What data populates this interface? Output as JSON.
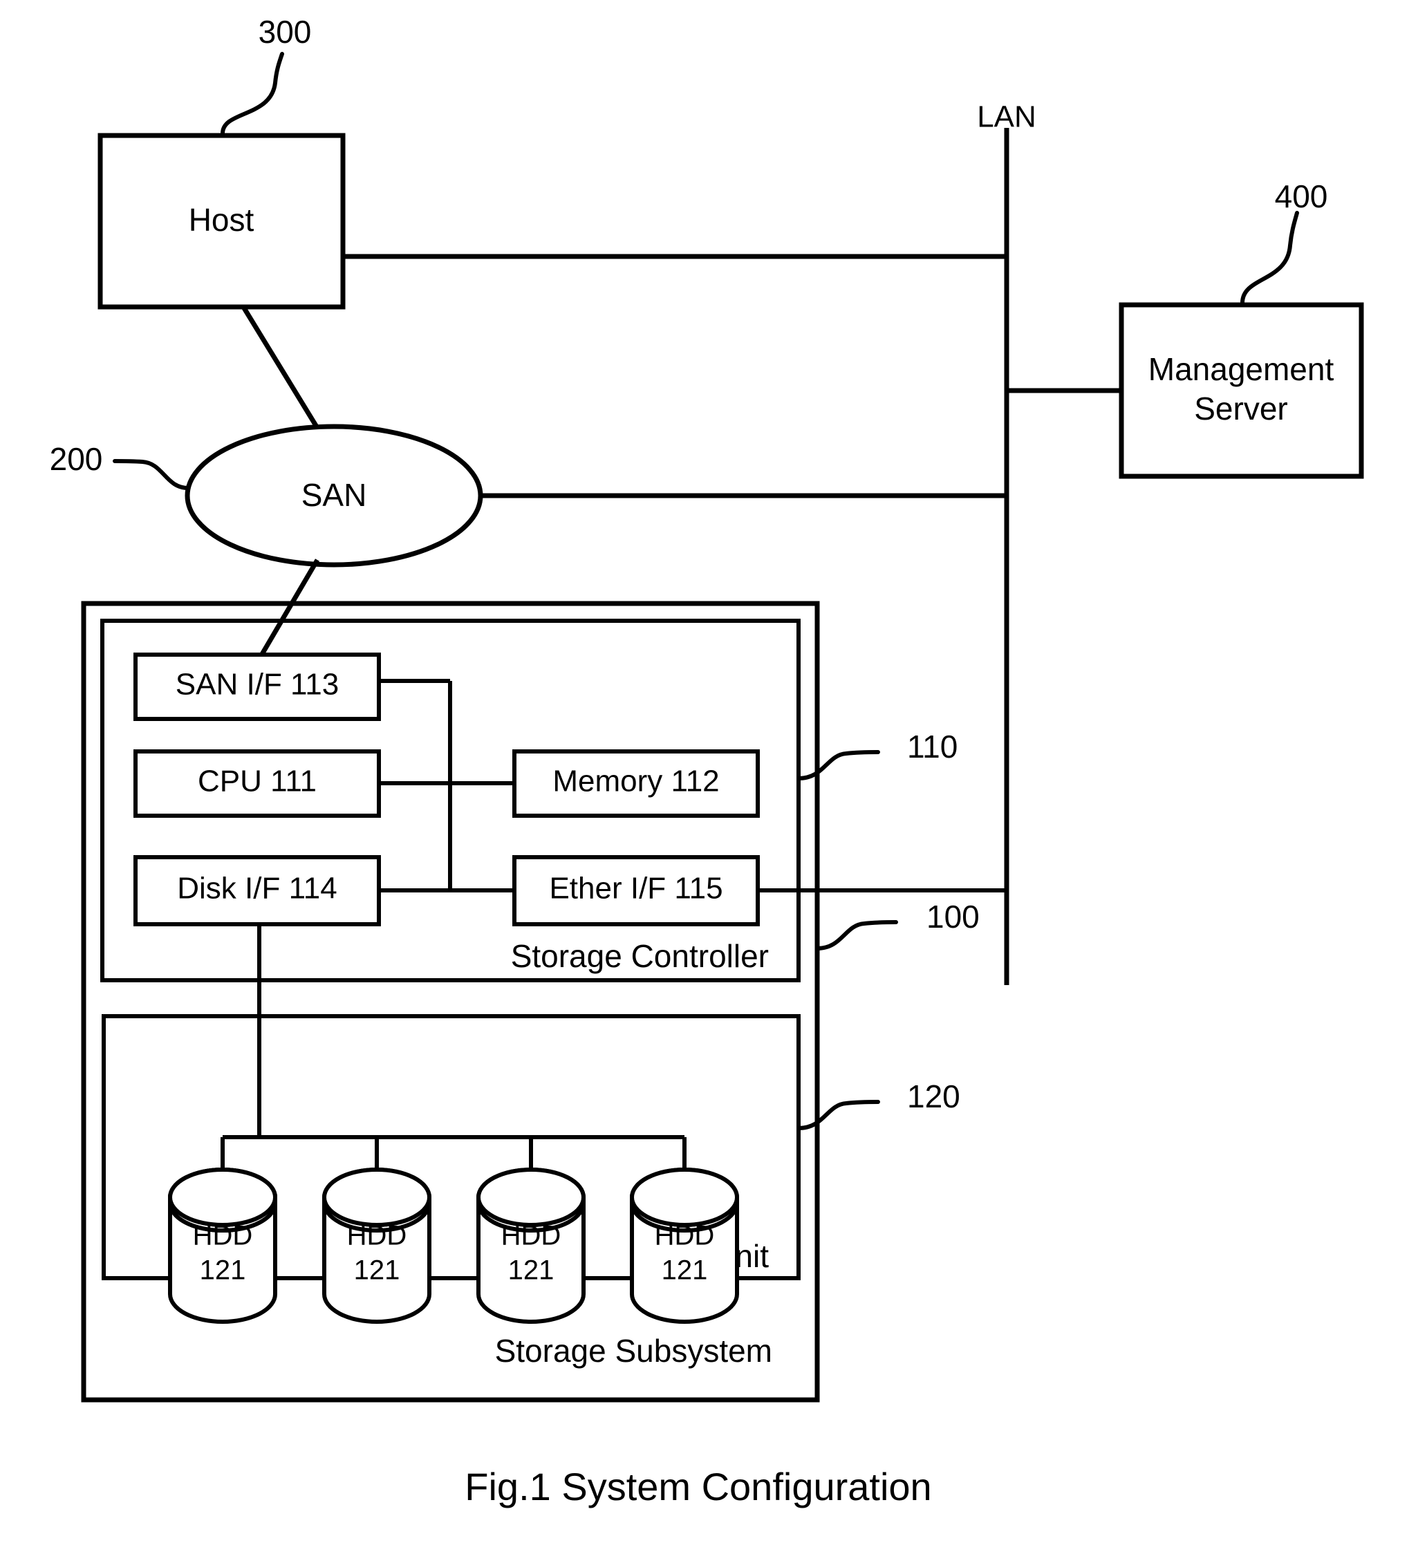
{
  "figure": {
    "caption": "Fig.1 System Configuration"
  },
  "nodes": {
    "host": {
      "label": "Host",
      "ref": "300"
    },
    "san": {
      "label": "SAN",
      "ref": "200"
    },
    "lan": {
      "label": "LAN"
    },
    "management_server": {
      "label_line1": "Management",
      "label_line2": "Server",
      "ref": "400"
    },
    "storage_subsystem": {
      "label": "Storage Subsystem",
      "ref": "100"
    },
    "storage_controller": {
      "label": "Storage Controller",
      "ref": "110"
    },
    "disk_unit": {
      "label": "Disk Unit",
      "ref": "120"
    }
  },
  "controller_components": [
    {
      "id": "san-if",
      "label": "SAN I/F 113"
    },
    {
      "id": "cpu",
      "label": "CPU 111"
    },
    {
      "id": "memory",
      "label": "Memory 112"
    },
    {
      "id": "disk-if",
      "label": "Disk I/F 114"
    },
    {
      "id": "ether-if",
      "label": "Ether I/F 115"
    }
  ],
  "hdds": [
    {
      "label_line1": "HDD",
      "label_line2": "121"
    },
    {
      "label_line1": "HDD",
      "label_line2": "121"
    },
    {
      "label_line1": "HDD",
      "label_line2": "121"
    },
    {
      "label_line1": "HDD",
      "label_line2": "121"
    }
  ],
  "colors": {
    "stroke": "#000000",
    "background": "#ffffff"
  }
}
